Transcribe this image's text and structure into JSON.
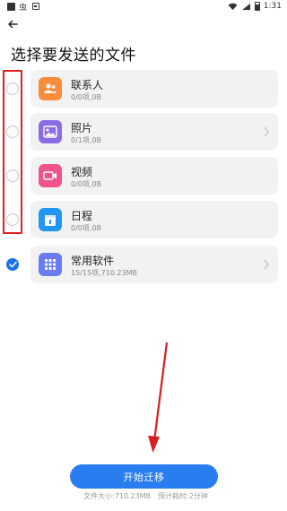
{
  "status_bar": {
    "app_label": "虫",
    "time": "1:31"
  },
  "page": {
    "title": "选择要发送的文件"
  },
  "items": [
    {
      "name": "联系人",
      "sub": "0/0项,0B",
      "icon": "contacts-icon",
      "color": "#f78c3b",
      "checked": false,
      "has_chevron": false
    },
    {
      "name": "照片",
      "sub": "0/1项,0B",
      "icon": "photo-icon",
      "color": "#8a6ce6",
      "checked": false,
      "has_chevron": true
    },
    {
      "name": "视频",
      "sub": "0/0项,0B",
      "icon": "video-icon",
      "color": "#f0548c",
      "checked": false,
      "has_chevron": false
    },
    {
      "name": "日程",
      "sub": "0/0项,0B",
      "icon": "calendar-icon",
      "color": "#2196f3",
      "checked": false,
      "has_chevron": false
    },
    {
      "name": "常用软件",
      "sub": "15/15项,710.23MB",
      "icon": "apps-icon",
      "color": "#6a7cf0",
      "checked": true,
      "has_chevron": true
    }
  ],
  "actions": {
    "start_label": "开始迁移"
  },
  "footer": {
    "file_size": "文件大小:710.23MB",
    "estimated_time": "预计耗时:2分钟"
  },
  "colors": {
    "accent": "#2a7df0",
    "highlight": "#e02020"
  }
}
